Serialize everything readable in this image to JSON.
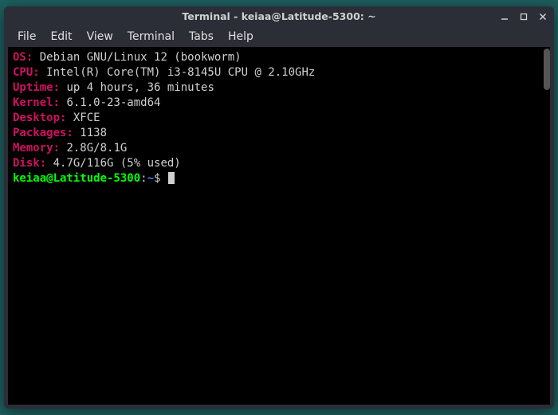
{
  "window": {
    "title": "Terminal - keiaa@Latitude-5300: ~"
  },
  "menubar": {
    "items": [
      "File",
      "Edit",
      "View",
      "Terminal",
      "Tabs",
      "Help"
    ]
  },
  "sysinfo": {
    "os_label": "OS:",
    "os_value": " Debian GNU/Linux 12 (bookworm)",
    "cpu_label": "CPU:",
    "cpu_value": " Intel(R) Core(TM) i3-8145U CPU @ 2.10GHz",
    "uptime_label": "Uptime:",
    "uptime_value": " up 4 hours, 36 minutes",
    "kernel_label": "Kernel:",
    "kernel_value": " 6.1.0-23-amd64",
    "desktop_label": "Desktop:",
    "desktop_value": " XFCE",
    "packages_label": "Packages:",
    "packages_value": " 1138",
    "memory_label": "Memory:",
    "memory_value": " 2.8G/8.1G",
    "disk_label": "Disk:",
    "disk_value": " 4.7G/116G (5% used)"
  },
  "prompt": {
    "user_host": "keiaa@Latitude-5300",
    "colon": ":",
    "path": "~",
    "dollar": "$ "
  }
}
